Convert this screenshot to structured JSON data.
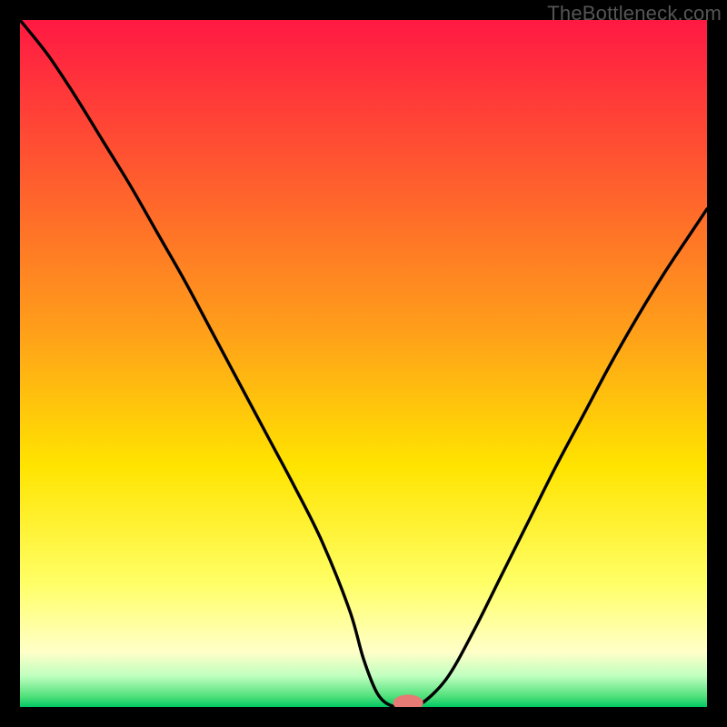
{
  "watermark": "TheBottleneck.com",
  "colors": {
    "background": "#000000",
    "gradient_stops": [
      {
        "offset": 0.0,
        "color": "#ff1943"
      },
      {
        "offset": 0.2,
        "color": "#ff5331"
      },
      {
        "offset": 0.45,
        "color": "#ff9e1a"
      },
      {
        "offset": 0.65,
        "color": "#ffe400"
      },
      {
        "offset": 0.82,
        "color": "#ffff66"
      },
      {
        "offset": 0.92,
        "color": "#ffffc8"
      },
      {
        "offset": 0.955,
        "color": "#bfffbf"
      },
      {
        "offset": 0.985,
        "color": "#4fe07a"
      },
      {
        "offset": 1.0,
        "color": "#00c864"
      }
    ],
    "curve": "#000000",
    "marker_fill": "#e77a74",
    "marker_stroke": "none"
  },
  "chart_data": {
    "type": "line",
    "title": "",
    "xlabel": "",
    "ylabel": "",
    "xlim": [
      0,
      100
    ],
    "ylim": [
      0,
      100
    ],
    "grid": false,
    "legend": false,
    "series": [
      {
        "name": "bottleneck-curve",
        "x": [
          0,
          4,
          8,
          12,
          16,
          20,
          24,
          28,
          32,
          36,
          40,
          44,
          48,
          50,
          52,
          54,
          56,
          58,
          62,
          66,
          70,
          74,
          78,
          82,
          86,
          90,
          94,
          98,
          100
        ],
        "y": [
          100,
          95,
          89,
          82.5,
          76,
          69,
          62,
          54.5,
          47,
          39.5,
          32,
          24,
          14,
          7,
          2,
          0.2,
          0.2,
          0.2,
          4,
          11,
          19,
          27,
          35,
          42.5,
          50,
          57,
          63.5,
          69.5,
          72.5
        ]
      }
    ],
    "flat_segment": {
      "x_start": 53.5,
      "x_end": 58.5,
      "y": 0.2
    },
    "marker": {
      "x": 56.5,
      "y": 0.6,
      "rx": 2.2,
      "ry": 1.2
    }
  }
}
